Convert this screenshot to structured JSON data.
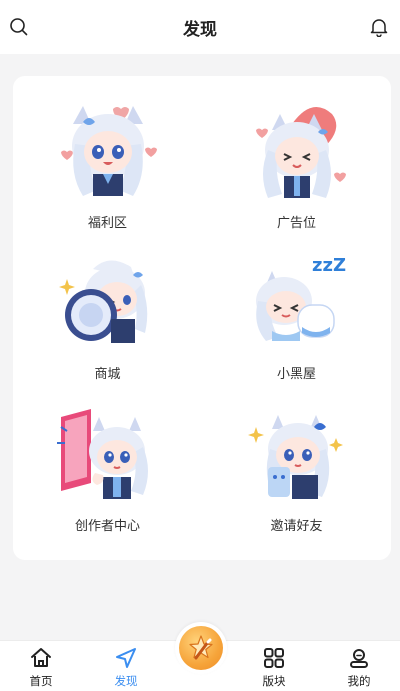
{
  "header": {
    "title": "发现",
    "left_icon": "search-icon",
    "right_icon": "bell-icon"
  },
  "grid": {
    "items": [
      {
        "label": "福利区",
        "icon": "welfare-sticker"
      },
      {
        "label": "广告位",
        "icon": "ad-slot-sticker"
      },
      {
        "label": "商城",
        "icon": "shop-sticker"
      },
      {
        "label": "小黑屋",
        "icon": "blackroom-sticker"
      },
      {
        "label": "创作者中心",
        "icon": "creator-center-sticker"
      },
      {
        "label": "邀请好友",
        "icon": "invite-friends-sticker"
      }
    ]
  },
  "tabbar": {
    "tabs": [
      {
        "label": "首页",
        "icon": "home-icon"
      },
      {
        "label": "发现",
        "icon": "navigate-icon",
        "active": true
      },
      {
        "label": "",
        "icon": "star-pen-icon"
      },
      {
        "label": "版块",
        "icon": "grid-icon"
      },
      {
        "label": "我的",
        "icon": "user-icon"
      }
    ]
  },
  "colors": {
    "accent": "#3b8ef0",
    "background": "#f4f4f5",
    "center_button": "#f6a43a"
  }
}
